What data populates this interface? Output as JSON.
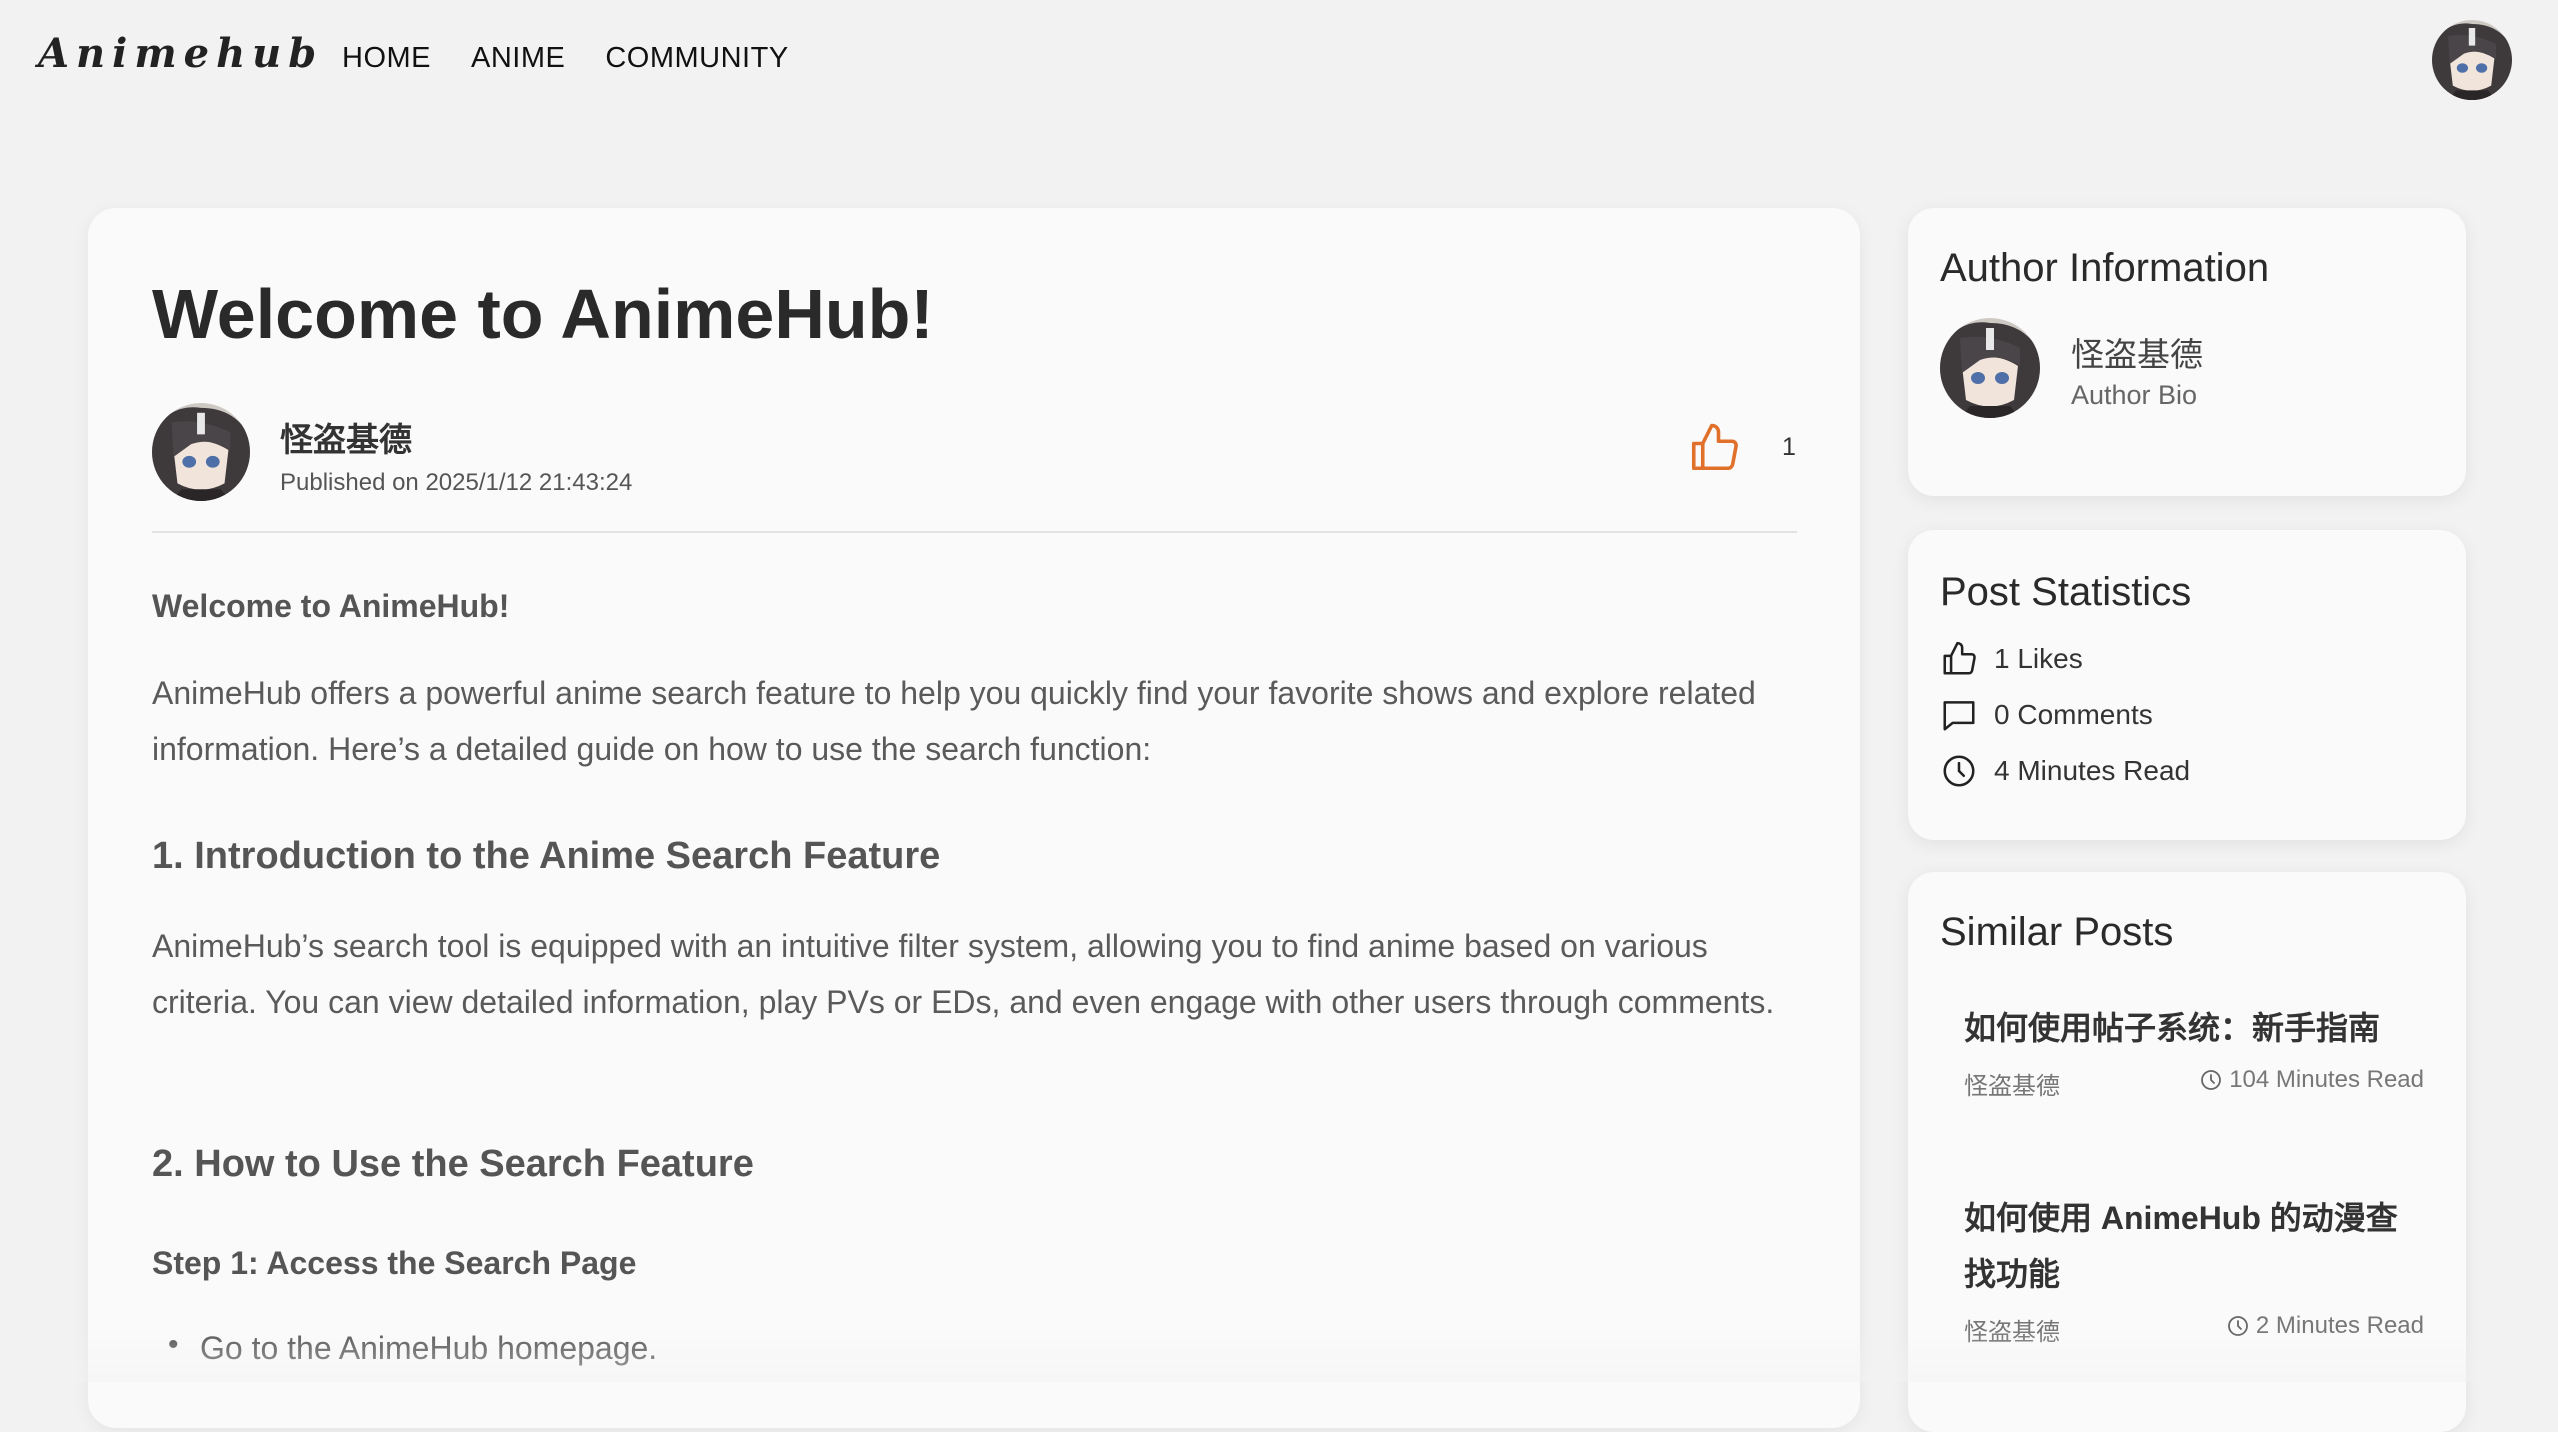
{
  "header": {
    "logo": "Animehub",
    "nav": [
      "HOME",
      "ANIME",
      "COMMUNITY"
    ],
    "avatar_icon": "user-avatar-icon"
  },
  "article": {
    "title": "Welcome to AnimeHub!",
    "author": "怪盗基德",
    "published": "Published on 2025/1/12 21:43:24",
    "like_count": "1",
    "like_icon": "thumbs-up-icon",
    "accent_color": "#e0702a",
    "intro_heading": "Welcome to AnimeHub!",
    "intro_paragraph": "AnimeHub offers a powerful anime search feature to help you quickly find your favorite shows and explore related information. Here’s a detailed guide on how to use the search function:",
    "section1_heading": "1. Introduction to the Anime Search Feature",
    "section1_paragraph": "AnimeHub’s search tool is equipped with an intuitive filter system, allowing you to find anime based on various criteria. You can view detailed information, play PVs or EDs, and even engage with other users through comments.",
    "section2_heading": "2. How to Use the Search Feature",
    "step1_heading": "Step 1: Access the Search Page",
    "step1_bullet": "Go to the AnimeHub homepage."
  },
  "sidebar": {
    "author_info": {
      "title": "Author Information",
      "name": "怪盗基德",
      "bio": "Author Bio"
    },
    "stats": {
      "title": "Post Statistics",
      "likes": "1 Likes",
      "comments": "0 Comments",
      "read_time": "4 Minutes Read"
    },
    "similar": {
      "title": "Similar Posts",
      "posts": [
        {
          "title": "如何使用帖子系统：新手指南",
          "author": "怪盗基德",
          "read_time": "104 Minutes Read"
        },
        {
          "title": "如何使用 AnimeHub 的动漫查找功能",
          "author": "怪盗基德",
          "read_time": "2 Minutes Read"
        }
      ]
    }
  }
}
